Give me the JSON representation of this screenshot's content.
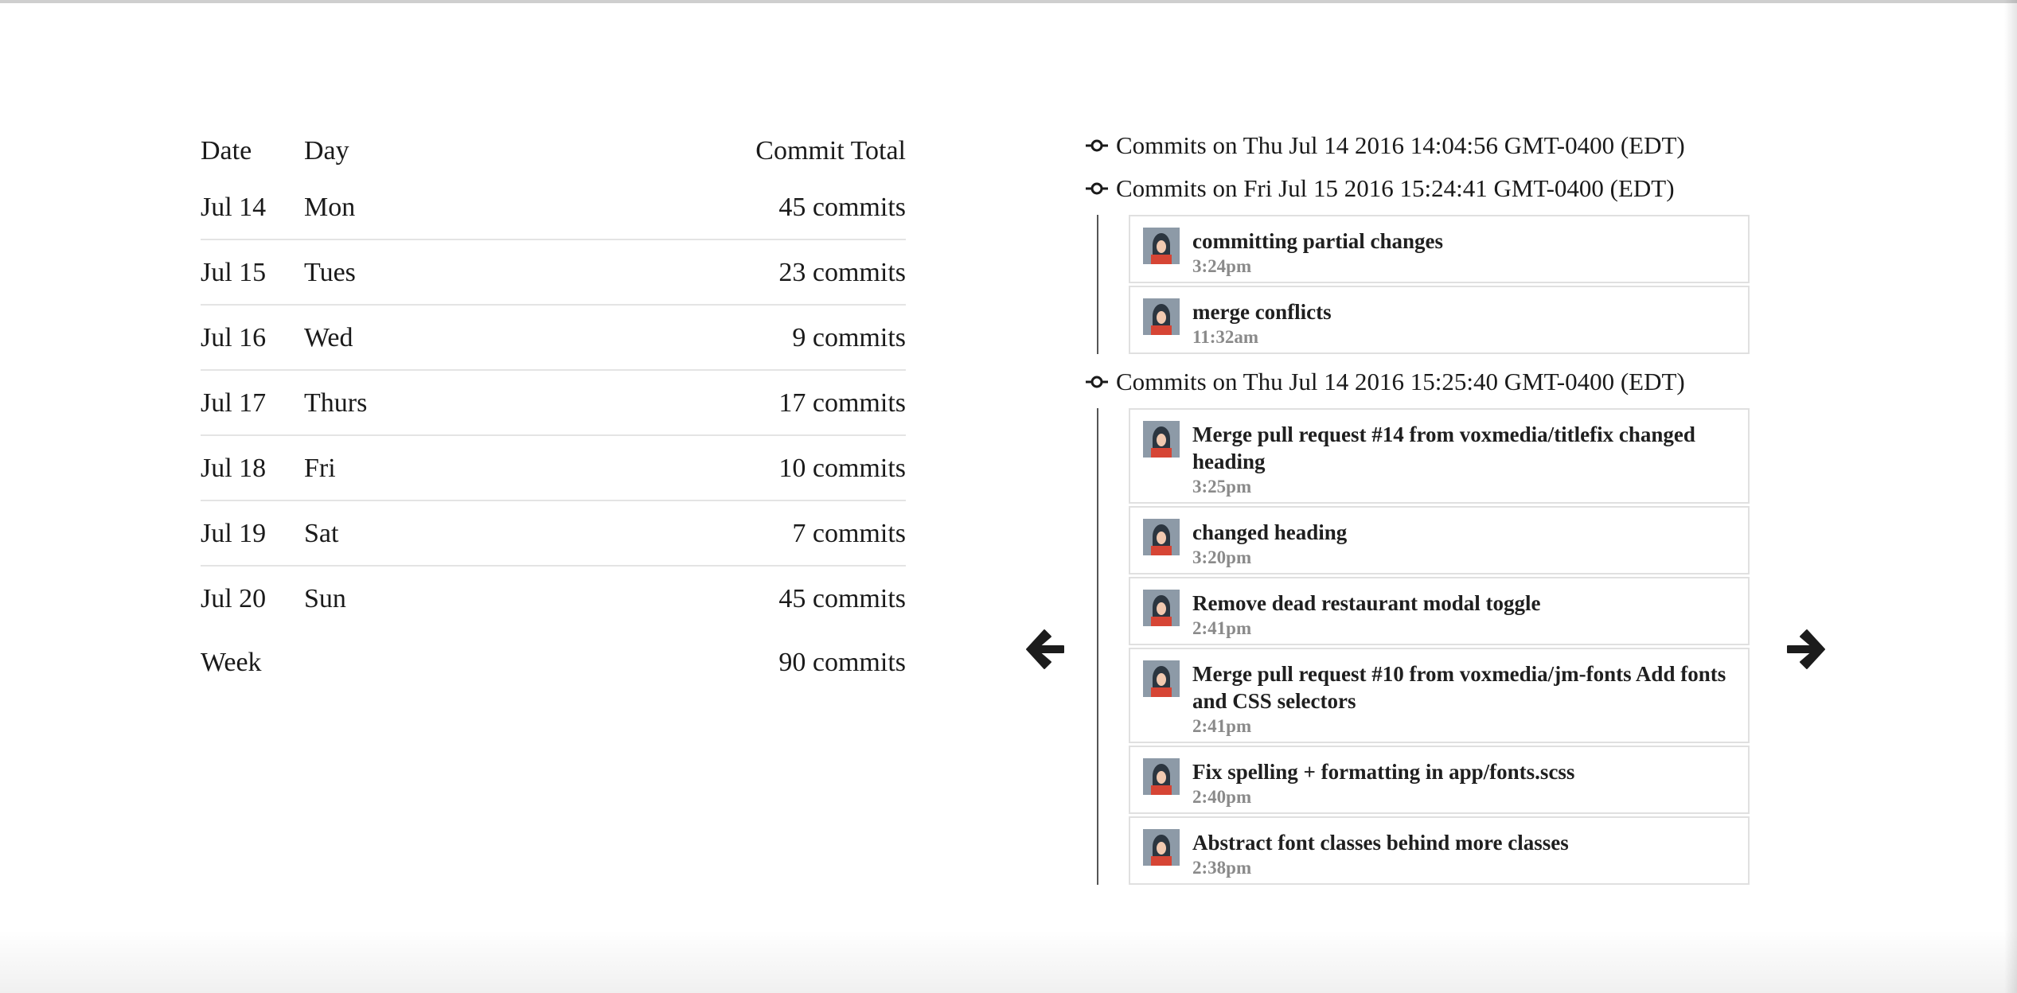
{
  "table": {
    "headers": {
      "date": "Date",
      "day": "Day",
      "total": "Commit Total"
    },
    "rows": [
      {
        "date": "Jul 14",
        "day": "Mon",
        "total": "45 commits"
      },
      {
        "date": "Jul 15",
        "day": "Tues",
        "total": "23 commits"
      },
      {
        "date": "Jul 16",
        "day": "Wed",
        "total": "9 commits"
      },
      {
        "date": "Jul 17",
        "day": "Thurs",
        "total": "17 commits"
      },
      {
        "date": "Jul 18",
        "day": "Fri",
        "total": "10 commits"
      },
      {
        "date": "Jul 19",
        "day": "Sat",
        "total": "7 commits"
      },
      {
        "date": "Jul 20",
        "day": "Sun",
        "total": "45 commits"
      }
    ],
    "footer": {
      "label": "Week",
      "total": "90 commits"
    }
  },
  "navigation": {
    "prev_icon": "arrow-left-icon",
    "next_icon": "arrow-right-icon"
  },
  "commit_groups": [
    {
      "heading": "Commits on Thu Jul 14 2016 14:04:56 GMT-0400 (EDT)",
      "commits": []
    },
    {
      "heading": "Commits on Fri Jul 15 2016 15:24:41 GMT-0400 (EDT)",
      "commits": [
        {
          "message": "committing partial changes",
          "time": "3:24pm"
        },
        {
          "message": "merge conflicts",
          "time": "11:32am"
        }
      ]
    },
    {
      "heading": "Commits on Thu Jul 14 2016 15:25:40 GMT-0400 (EDT)",
      "commits": [
        {
          "message": "Merge pull request #14 from voxmedia/titlefix changed heading",
          "time": "3:25pm"
        },
        {
          "message": "changed heading",
          "time": "3:20pm"
        },
        {
          "message": "Remove dead restaurant modal toggle",
          "time": "2:41pm"
        },
        {
          "message": "Merge pull request #10 from voxmedia/jm-fonts Add fonts and CSS selectors",
          "time": "2:41pm"
        },
        {
          "message": "Fix spelling + formatting in app/fonts.scss",
          "time": "2:40pm"
        },
        {
          "message": "Abstract font classes behind more classes",
          "time": "2:38pm"
        }
      ]
    }
  ],
  "colors": {
    "text": "#1a1a1a",
    "muted_time": "#8a8a8a",
    "card_border": "#e0e0e0",
    "row_divider": "#e4e4e4",
    "timeline_line": "#555555"
  }
}
